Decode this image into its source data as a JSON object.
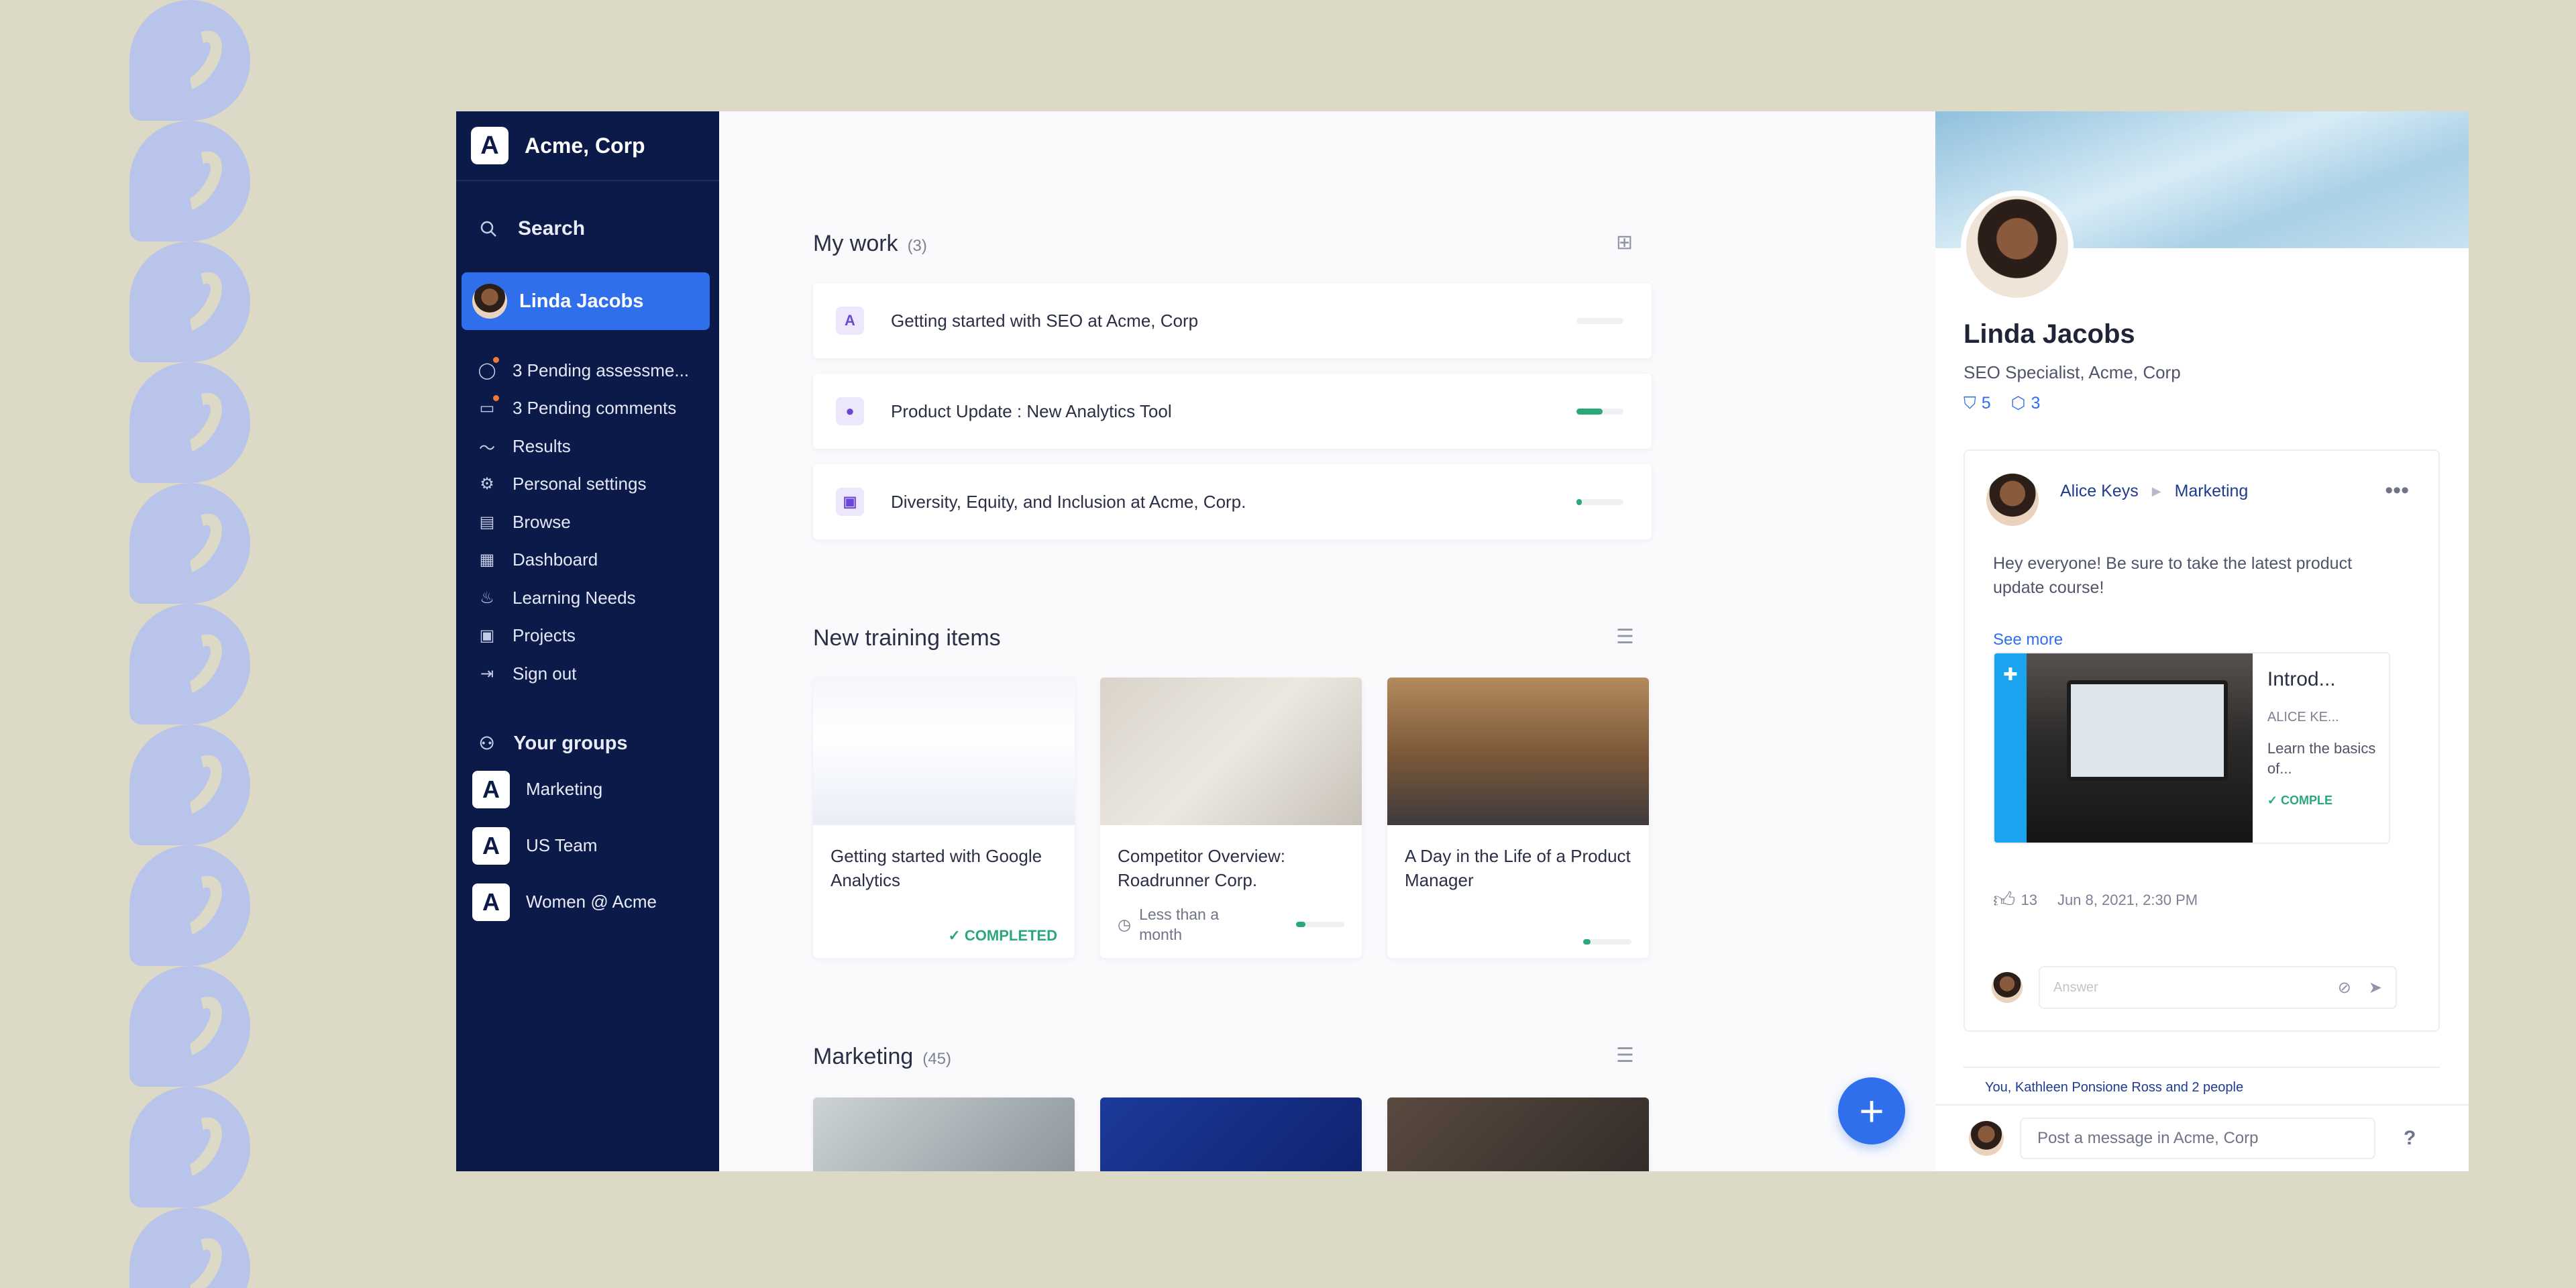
{
  "brand": {
    "name": "Acme, Corp",
    "logo_letter": "A"
  },
  "search": {
    "label": "Search"
  },
  "user": {
    "name": "Linda Jacobs"
  },
  "nav": [
    {
      "icon": "check-circle-icon",
      "label": "3 Pending assessme...",
      "alert": true
    },
    {
      "icon": "comment-icon",
      "label": "3 Pending comments",
      "alert": true
    },
    {
      "icon": "pulse-icon",
      "label": "Results"
    },
    {
      "icon": "gear-icon",
      "label": "Personal settings"
    },
    {
      "icon": "browse-icon",
      "label": "Browse"
    },
    {
      "icon": "dashboard-icon",
      "label": "Dashboard"
    },
    {
      "icon": "flame-icon",
      "label": "Learning Needs"
    },
    {
      "icon": "projects-icon",
      "label": "Projects"
    },
    {
      "icon": "sign-out-icon",
      "label": "Sign out"
    }
  ],
  "groups": {
    "title": "Your groups",
    "items": [
      {
        "label": "Marketing",
        "logo_letter": "A"
      },
      {
        "label": "US Team",
        "logo_letter": "A"
      },
      {
        "label": "Women @ Acme",
        "logo_letter": "A"
      }
    ]
  },
  "my_work": {
    "title": "My work",
    "count": "(3)",
    "items": [
      {
        "badge": "A",
        "title": "Getting started with SEO at Acme, Corp",
        "progress": 0.0
      },
      {
        "badge": "●",
        "title": "Product Update : New Analytics Tool",
        "progress": 0.55
      },
      {
        "badge": "▣",
        "title": "Diversity, Equity, and Inclusion at Acme, Corp.",
        "progress": 0.12
      }
    ]
  },
  "training": {
    "title": "New training items",
    "items": [
      {
        "title": "Getting started with Google Analytics",
        "status": "COMPLETED"
      },
      {
        "title": "Competitor Overview: Roadrunner Corp.",
        "duration": "Less than a month",
        "progress": 0.2
      },
      {
        "title": "A Day in the Life of a Product Manager",
        "progress": 0.15
      }
    ]
  },
  "marketing": {
    "title": "Marketing",
    "count": "(45)"
  },
  "profile": {
    "name": "Linda Jacobs",
    "role": "SEO Specialist, Acme, Corp",
    "badges": "5",
    "points": "3",
    "post": {
      "author": "Alice Keys",
      "group": "Marketing",
      "text": "Hey everyone! Be sure to take the latest product update course!",
      "see_more": "See more",
      "embed": {
        "title": "Introd...",
        "author": "ALICE KE...",
        "desc": "Learn the basics of...",
        "status": "COMPLE"
      },
      "likes": "13",
      "date": "Jun 8, 2021, 2:30 PM",
      "reply_placeholder": "Answer"
    },
    "next_post_preview": "You, Kathleen Ponsione Ross and 2 people",
    "composer_placeholder": "Post a message in Acme, Corp"
  },
  "colors": {
    "sidebar": "#0c1a4a",
    "accent": "#2f6fec",
    "success": "#2aa87a",
    "page_bg": "#ddd9c7"
  }
}
